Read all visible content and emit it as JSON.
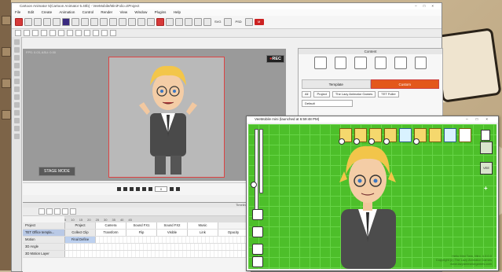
{
  "ca": {
    "title": "Cartoon Animator 5(Cartoon Animator 5.40b) - VeeMobile/MiniFolio.ctProject",
    "menu": [
      "File",
      "Edit",
      "Create",
      "Animation",
      "Control",
      "Render",
      "View",
      "Window",
      "Plugins",
      "Help"
    ],
    "toolbar_labels": {
      "svg": "SVG",
      "psd": "PSD",
      "mi": "M"
    },
    "stage_info": "FPS: 0.03, ASU: 0.00",
    "rec_label": "REC",
    "stage_mode": "STAGE MODE",
    "frame_value": "0",
    "timeline_title": "Timeline"
  },
  "content": {
    "title": "Content",
    "tabs": [
      {
        "label": "Template"
      },
      {
        "label": "Custom"
      }
    ],
    "breadcrumbs": [
      "All",
      "Project",
      "The Lazy Animator Games",
      "TET Fuller"
    ],
    "dropdown": "Default"
  },
  "timeline": {
    "ruler": [
      "5",
      "10",
      "15",
      "20",
      "25",
      "30",
      "35",
      "40",
      "45"
    ],
    "rows": [
      {
        "label": "Project",
        "cells": [
          "Project",
          "Camera",
          "Sound FX1",
          "Sound FX2",
          "Music"
        ]
      },
      {
        "label": "TET Office templa...",
        "cells": [
          "Collect Clip",
          "Transform",
          "Flip",
          "Visible",
          "Link",
          "Opacity"
        ]
      },
      {
        "label": "Motion",
        "cells": [
          "Final Define"
        ]
      },
      {
        "label": "3D Angle",
        "cells": []
      },
      {
        "label": "3D Motion Layer",
        "cells": []
      }
    ]
  },
  "vtm": {
    "title": "VeeMobile mini (launched at 6:59:48 PM)",
    "thumb_label": "VEE",
    "watermark_line1": "Hello Mini Twin, Mini, 4.0.0.0",
    "watermark_line2": "Copyright (c) The Lazy Animator Games",
    "watermark_line3": "www.lazyanimatorgames.com"
  },
  "colors": {
    "green": "#4dbf2a",
    "accent": "#e3581b",
    "rec": "#e33333"
  }
}
